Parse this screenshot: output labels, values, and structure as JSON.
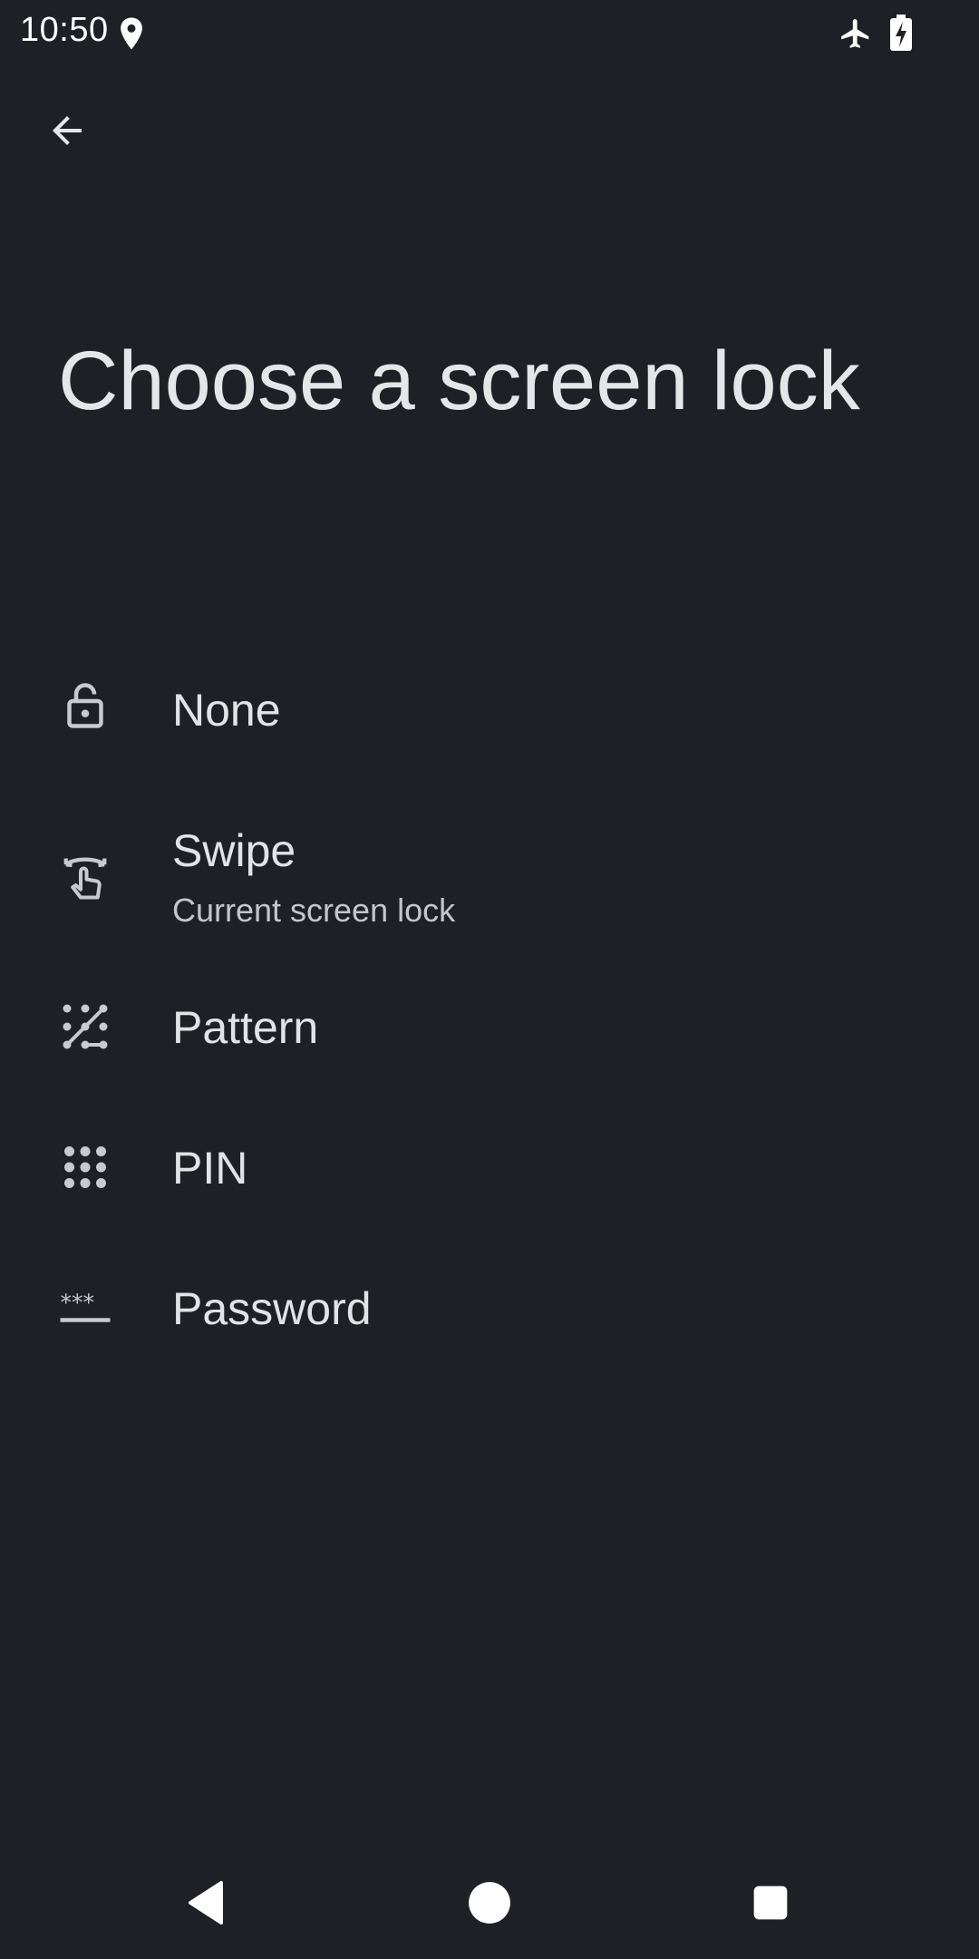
{
  "status_bar": {
    "time": "10:50",
    "icons": [
      "location-icon",
      "airplane-mode-icon",
      "battery-charging-icon"
    ]
  },
  "toolbar": {
    "back_icon": "arrow-back-icon"
  },
  "page": {
    "title": "Choose a screen lock"
  },
  "options": [
    {
      "label": "None",
      "icon": "lock-open-icon"
    },
    {
      "label": "Swipe",
      "subtitle": "Current screen lock",
      "icon": "swipe-icon"
    },
    {
      "label": "Pattern",
      "icon": "pattern-icon"
    },
    {
      "label": "PIN",
      "icon": "pin-dots-icon"
    },
    {
      "label": "Password",
      "icon": "password-icon"
    }
  ],
  "nav_bar": {
    "buttons": [
      "back-triangle-icon",
      "home-circle-icon",
      "recents-square-icon"
    ]
  },
  "colors": {
    "background": "#1e2026",
    "text": "#e3e3e6",
    "subtext": "#c4c6cf"
  }
}
